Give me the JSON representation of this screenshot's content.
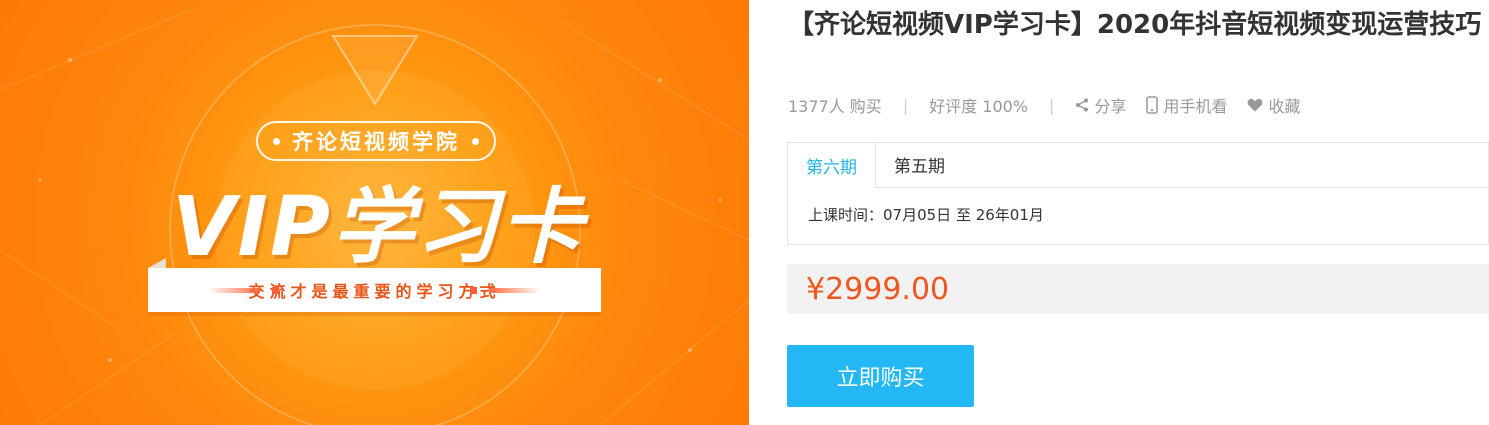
{
  "banner": {
    "school": "齐论短视频学院",
    "headline": "VIP学习卡",
    "slogan": "交流才是最重要的学习方式"
  },
  "product": {
    "title": "【齐论短视频VIP学习卡】2020年抖音短视频变现运营技巧"
  },
  "meta": {
    "buyers": "1377人 购买",
    "rating": "好评度 100%",
    "share_label": "分享",
    "mobile_label": "用手机看",
    "favorite_label": "收藏"
  },
  "tabs": [
    {
      "label": "第六期",
      "active": true
    },
    {
      "label": "第五期",
      "active": false
    }
  ],
  "schedule": "上课时间：07月05日 至 26年01月",
  "price": "¥2999.00",
  "buy_label": "立即购买",
  "colors": {
    "accent": "#23b7e5",
    "price": "#f2561d",
    "banner": "#ff8a0c"
  }
}
